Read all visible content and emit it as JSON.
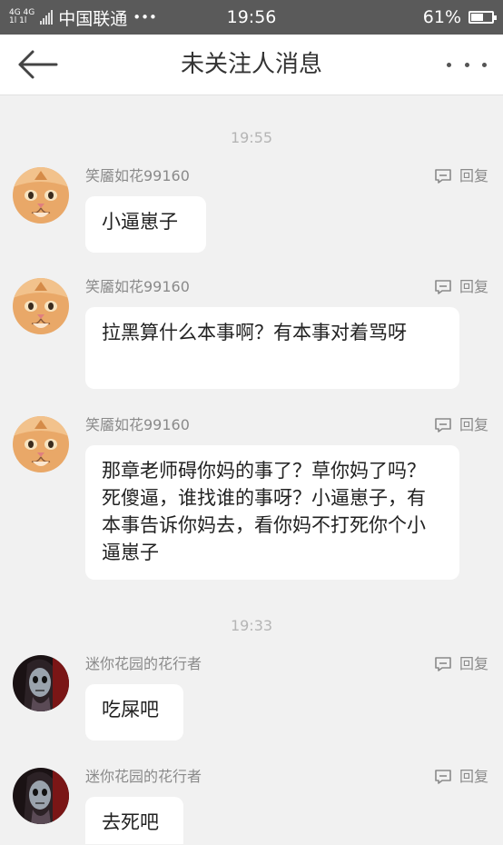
{
  "status_bar": {
    "network_top": "4G 4G",
    "network_bottom": "1l 1l",
    "carrier": "中国联通",
    "carrier_more": "•••",
    "time": "19:56",
    "battery_text": "61%",
    "battery_level": 0.61
  },
  "nav": {
    "title": "未关注人消息"
  },
  "timestamps": [
    "19:55",
    "19:33"
  ],
  "messages": [
    {
      "sender": "笑靥如花99160",
      "reply": "回复",
      "text": "小逼崽子",
      "avatar": "cat"
    },
    {
      "sender": "笑靥如花99160",
      "reply": "回复",
      "text": "拉黑算什么本事啊？有本事对着骂呀",
      "avatar": "cat"
    },
    {
      "sender": "笑靥如花99160",
      "reply": "回复",
      "text": "那章老师碍你妈的事了？草你妈了吗？死傻逼，谁找谁的事呀？小逼崽子，有本事告诉你妈去，看你妈不打死你个小逼崽子",
      "avatar": "cat"
    },
    {
      "sender": "迷你花园的花行者",
      "reply": "回复",
      "text": "吃屎吧",
      "avatar": "doll"
    },
    {
      "sender": "迷你花园的花行者",
      "reply": "回复",
      "text": "去死吧",
      "avatar": "doll"
    }
  ]
}
